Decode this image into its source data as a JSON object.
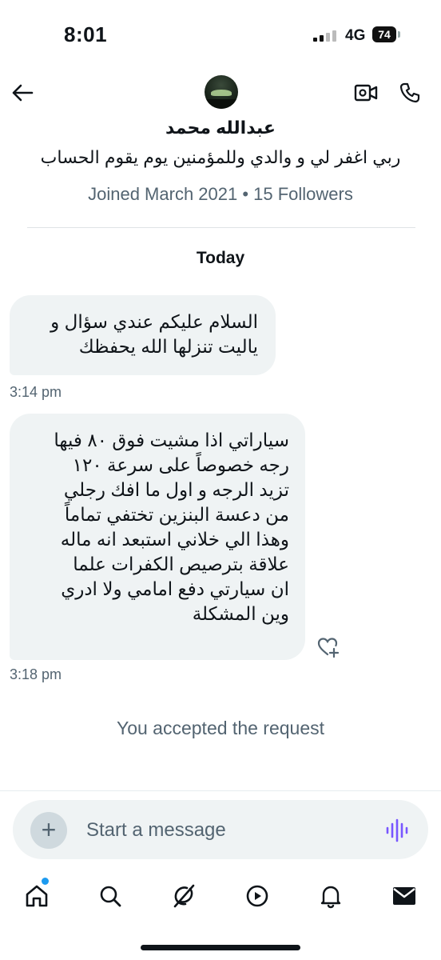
{
  "status_bar": {
    "time": "8:01",
    "network": "4G",
    "battery": "74"
  },
  "header": {
    "display_name": "عبدالله محمد",
    "bio": "ربي اغفر لي و والدي وللمؤمنين يوم يقوم الحساب",
    "joined": "Joined March 2021 • 15 Followers"
  },
  "conversation": {
    "date_separator": "Today",
    "messages": [
      {
        "lines": [
          "السلام عليكم عندي سؤال و",
          "ياليت تنزلها الله يحفظك"
        ],
        "time": "3:14 pm"
      },
      {
        "lines": [
          "سياراتي اذا مشيت فوق ٨٠ فيها",
          "رجه  خصوصاً على سرعة ١٢٠",
          "تزيد  الرجه  و اول ما افك رجلي",
          "من دعسة البنزين تختفي تماماً",
          "وهذا الي خلاني استبعد انه ماله",
          "علاقة بترصيص الكفرات  علما",
          "ان سيارتي دفع امامي ولا ادري",
          "وين المشكلة"
        ],
        "time": "3:18 pm"
      }
    ],
    "system_notice": "You accepted the request"
  },
  "composer": {
    "placeholder": "Start a message",
    "plus_label": "+"
  },
  "icons": {
    "back": "arrow-left-icon",
    "video": "video-camera-icon",
    "phone": "phone-icon",
    "react": "heart-plus-icon",
    "voice": "voice-wave-icon",
    "tabs": [
      "home-icon",
      "search-icon",
      "grok-icon",
      "video-play-icon",
      "bell-icon",
      "mail-icon"
    ]
  },
  "colors": {
    "accent": "#1d9bf0",
    "bubble": "#eff3f4",
    "muted": "#536471",
    "voice": "#7856ff"
  }
}
